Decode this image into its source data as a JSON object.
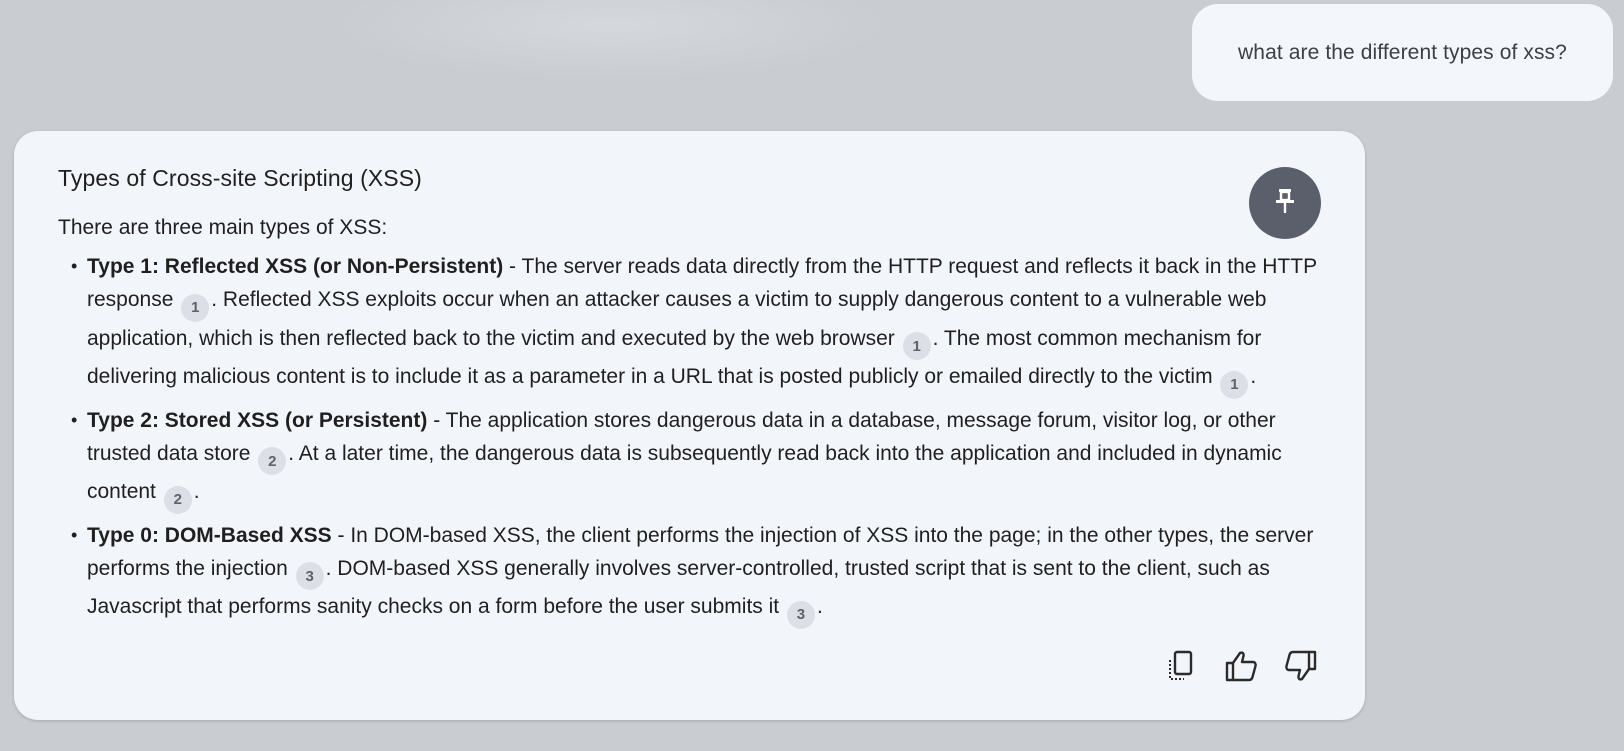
{
  "user_message": {
    "text": "what are the different types of xss?"
  },
  "response": {
    "title": "Types of Cross-site Scripting (XSS)",
    "intro": "There are three main types of XSS:",
    "items": [
      {
        "heading": "Type 1: Reflected XSS (or Non-Persistent)",
        "t1": " - The server reads data directly from the HTTP request and reflects it back in the HTTP response ",
        "c1": "1",
        "t2": ". Reflected XSS exploits occur when an attacker causes a victim to supply dangerous content to a vulnerable web application, which is then reflected back to the victim and executed by the web browser ",
        "c2": "1",
        "t3": ". The most common mechanism for delivering malicious content is to include it as a parameter in a URL that is posted publicly or emailed directly to the victim ",
        "c3": "1",
        "t4": "."
      },
      {
        "heading": "Type 2: Stored XSS (or Persistent)",
        "t1": " - The application stores dangerous data in a database, message forum, visitor log, or other trusted data store ",
        "c1": "2",
        "t2": ". At a later time, the dangerous data is subsequently read back into the application and included in dynamic content ",
        "c2": "2",
        "t3": "."
      },
      {
        "heading": "Type 0: DOM-Based XSS",
        "t1": " - In DOM-based XSS, the client performs the injection of XSS into the page; in the other types, the server performs the injection ",
        "c1": "3",
        "t2": ". DOM-based XSS generally involves server-controlled, trusted script that is sent to the client, such as Javascript that performs sanity checks on a form before the user submits it ",
        "c2": "3",
        "t3": "."
      }
    ],
    "bullet": "•"
  },
  "icons": {
    "pin": "pin-icon",
    "copy": "copy-icon",
    "like": "thumbs-up-icon",
    "dislike": "thumbs-down-icon"
  },
  "colors": {
    "background": "#c9cdd2",
    "card": "#f2f5fa",
    "pin_button": "#5b5f6b",
    "citation_chip": "#dcdfe5"
  }
}
